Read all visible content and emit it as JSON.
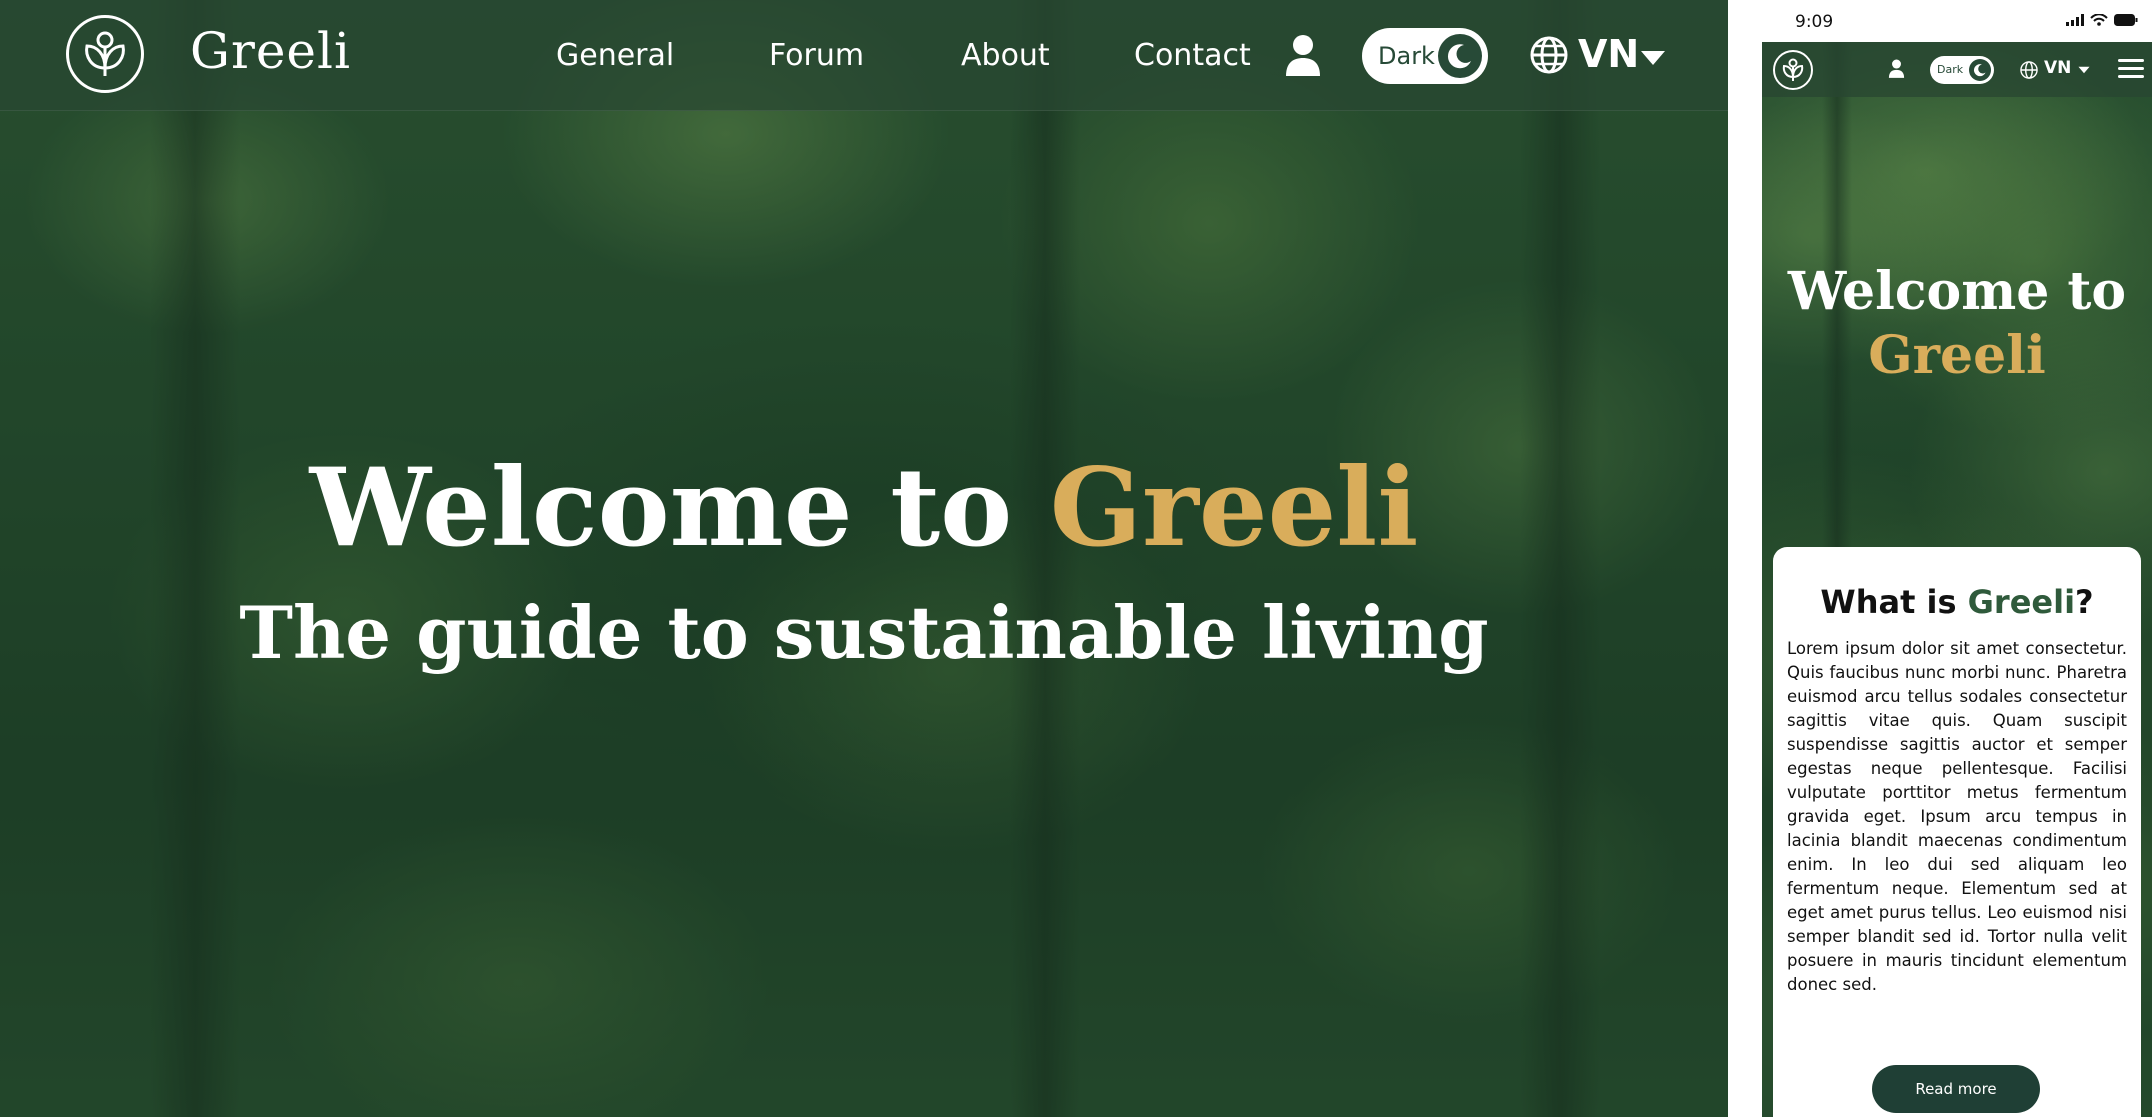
{
  "desktop": {
    "brand": "Greeli",
    "nav": {
      "items": [
        "General",
        "Forum",
        "About",
        "Contact"
      ]
    },
    "theme_toggle_label": "Dark",
    "language": "VN",
    "hero": {
      "title_prefix": "Welcome to",
      "title_accent": "Greeli",
      "subtitle": "The guide to sustainable living"
    }
  },
  "mobile": {
    "status_time": "9:09",
    "theme_toggle_label": "Dark",
    "language": "VN",
    "hero": {
      "title_prefix": "Welcome to",
      "title_accent": "Greeli"
    },
    "card": {
      "title_prefix": "What is",
      "title_accent": "Greeli",
      "title_suffix": "?",
      "body": "Lorem ipsum dolor sit amet consectetur. Quis faucibus nunc morbi nunc. Pharetra euismod arcu tellus sodales consectetur sagittis vitae quis. Quam suscipit suspendisse sagittis auctor et semper egestas neque pellentesque. Facilisi vulputate porttitor metus fermentum gravida eget. Ipsum arcu tempus in lacinia blandit maecenas condimentum enim. In leo dui sed aliquam leo fermentum neque. Elementum sed at eget amet purus tellus. Leo euismod nisi semper blandit sed id. Tortor nulla velit posuere in mauris tincidunt elementum donec sed.",
      "button_label": "Read more"
    }
  },
  "colors": {
    "accent_gold": "#d9ad5b",
    "brand_green": "#2f5a3b",
    "button_dark_green": "#1f3f35",
    "nav_green": "#284632"
  },
  "icons": [
    "logo-icon",
    "user-icon",
    "moon-icon",
    "globe-icon",
    "caret-down-icon",
    "menu-icon"
  ]
}
